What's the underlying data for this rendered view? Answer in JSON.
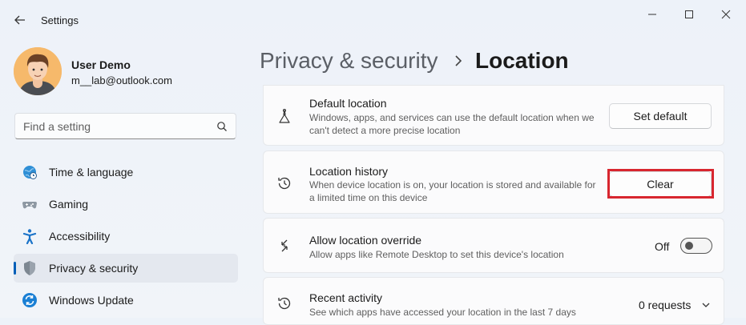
{
  "window": {
    "title": "Settings"
  },
  "user": {
    "name": "User Demo",
    "email": "m__lab@outlook.com"
  },
  "search": {
    "placeholder": "Find a setting"
  },
  "sidebar": {
    "items": [
      {
        "label": "Time & language",
        "icon": "globe-clock-icon"
      },
      {
        "label": "Gaming",
        "icon": "gamepad-icon"
      },
      {
        "label": "Accessibility",
        "icon": "accessibility-icon"
      },
      {
        "label": "Privacy & security",
        "icon": "shield-icon",
        "selected": true
      },
      {
        "label": "Windows Update",
        "icon": "sync-icon"
      }
    ]
  },
  "breadcrumb": {
    "parent": "Privacy & security",
    "current": "Location"
  },
  "settings": {
    "default_location": {
      "title": "Default location",
      "desc": "Windows, apps, and services can use the default location when we can't detect a more precise location",
      "button": "Set default"
    },
    "location_history": {
      "title": "Location history",
      "desc": "When device location is on, your location is stored and available for a limited time on this device",
      "button": "Clear"
    },
    "location_override": {
      "title": "Allow location override",
      "desc": "Allow apps like Remote Desktop to set this device's location",
      "state": "Off"
    },
    "recent_activity": {
      "title": "Recent activity",
      "desc": "See which apps have accessed your location in the last 7 days",
      "value": "0 requests"
    }
  },
  "colors": {
    "accent": "#005fb8",
    "highlight_box": "#d8262f"
  }
}
